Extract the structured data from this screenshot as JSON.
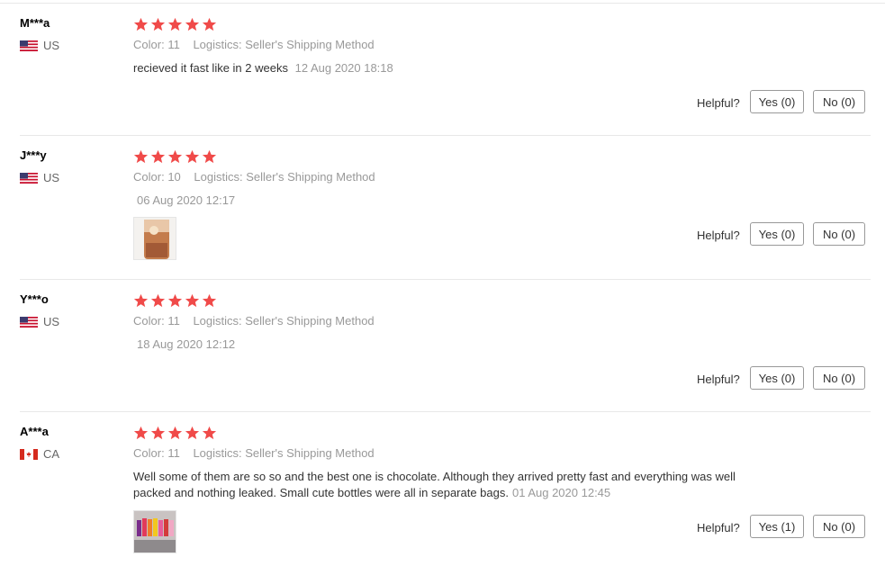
{
  "labels": {
    "color": "Color:",
    "logistics": "Logistics:",
    "helpful": "Helpful?"
  },
  "colors": {
    "star": "#f04a49",
    "accent": "#f04a49"
  },
  "reviews": [
    {
      "user": "M***a",
      "country": "US",
      "flag": "us-flag-icon",
      "stars": 5,
      "color_value": "11",
      "logistics_value": "Seller's Shipping Method",
      "text": "recieved it fast like in 2 weeks",
      "date": "12 Aug 2020 18:18",
      "yes": "Yes (0)",
      "no": "No (0)"
    },
    {
      "user": "J***y",
      "country": "US",
      "flag": "us-flag-icon",
      "stars": 5,
      "color_value": "10",
      "logistics_value": "Seller's Shipping Method",
      "text": "",
      "date": "06 Aug 2020 12:17",
      "yes": "Yes (0)",
      "no": "No (0)"
    },
    {
      "user": "Y***o",
      "country": "US",
      "flag": "us-flag-icon",
      "stars": 5,
      "color_value": "11",
      "logistics_value": "Seller's Shipping Method",
      "text": "",
      "date": "18 Aug 2020 12:12",
      "yes": "Yes (0)",
      "no": "No (0)"
    },
    {
      "user": "A***a",
      "country": "CA",
      "flag": "ca-flag-icon",
      "stars": 5,
      "color_value": "11",
      "logistics_value": "Seller's Shipping Method",
      "text_line1": "Well some of them are so so and the best one is chocolate. Although they arrived pretty fast and everything was well",
      "text_line2": "packed and nothing leaked. Small cute bottles were all in separate bags.",
      "date": "01 Aug 2020 12:45",
      "yes": "Yes (1)",
      "no": "No (0)"
    }
  ]
}
